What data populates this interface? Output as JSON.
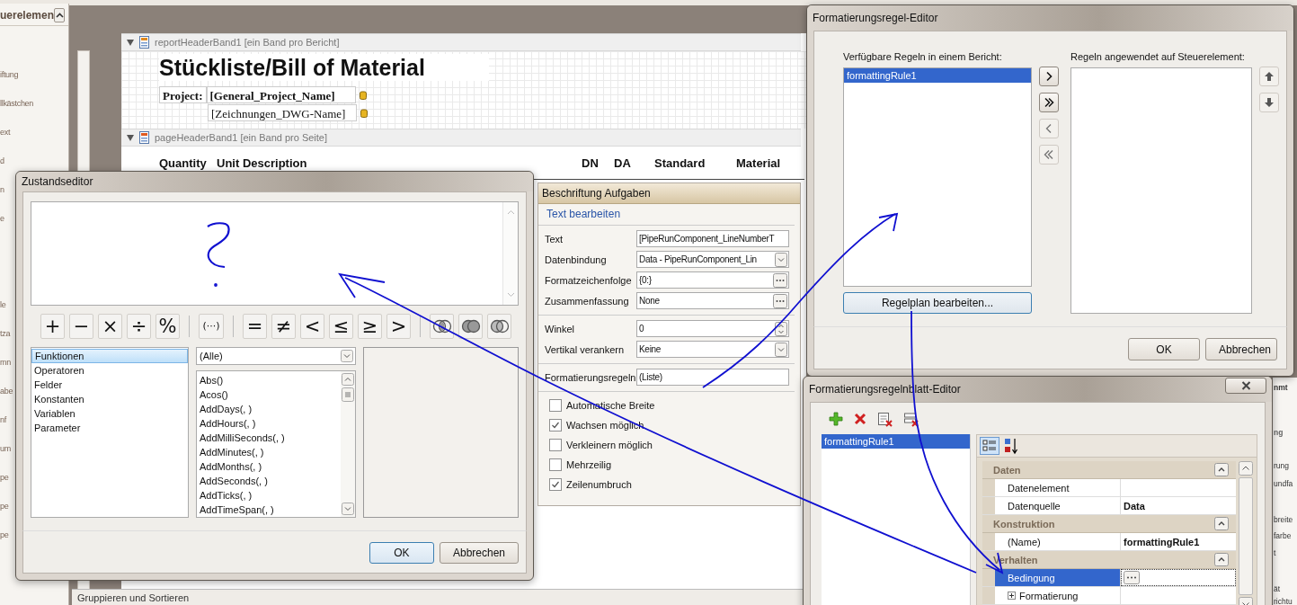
{
  "sidebar": {
    "header": "uerelemen",
    "items": [
      "iftung",
      "llkästchen",
      "ext",
      "d",
      "n",
      "e"
    ],
    "lower_items": [
      "le",
      "tza",
      "mn",
      "abe",
      "nf",
      "um",
      "pe",
      "pe",
      "pe"
    ]
  },
  "report": {
    "bands": [
      {
        "name": "reportHeaderBand1 [ein Band pro Bericht]",
        "kind": "report"
      },
      {
        "name": "pageHeaderBand1 [ein Band pro Seite]",
        "kind": "page"
      }
    ],
    "title": "Stückliste/Bill of Material",
    "project_label": "Project:",
    "fields": [
      {
        "text": "[General_Project_Name]",
        "bold": true
      },
      {
        "text": "[Zeichnungen_DWG-Name]",
        "bold": false
      }
    ],
    "columns": [
      "Quantity",
      "Unit Description",
      "DN",
      "DA",
      "Standard",
      "Material"
    ]
  },
  "bottom_tab": "Gruppieren und Sortieren",
  "right_fragments": [
    "nmt",
    "ng",
    "rung",
    "undfa",
    "breite",
    "farbe",
    "t",
    "ät",
    "richtu"
  ],
  "condition_editor": {
    "title": "Zustandseditor",
    "operators": [
      {
        "text": "+",
        "kind": "char"
      },
      {
        "text": "−",
        "kind": "char"
      },
      {
        "text": "×",
        "kind": "char"
      },
      {
        "text": "÷",
        "kind": "char"
      },
      {
        "text": "%",
        "kind": "char"
      },
      {
        "kind": "sep"
      },
      {
        "text": "(···)",
        "kind": "char"
      },
      {
        "kind": "sep"
      },
      {
        "text": "=",
        "kind": "char"
      },
      {
        "text": "≠",
        "kind": "char"
      },
      {
        "text": "<",
        "kind": "char"
      },
      {
        "text": "≤",
        "kind": "char"
      },
      {
        "text": "≥",
        "kind": "char"
      },
      {
        "text": ">",
        "kind": "char"
      },
      {
        "kind": "sep"
      },
      {
        "kind": "and"
      },
      {
        "kind": "or"
      },
      {
        "kind": "not"
      }
    ],
    "categories": [
      {
        "label": "Funktionen",
        "selected": true
      },
      {
        "label": "Operatoren",
        "selected": false
      },
      {
        "label": "Felder",
        "selected": false
      },
      {
        "label": "Konstanten",
        "selected": false
      },
      {
        "label": "Variablen",
        "selected": false
      },
      {
        "label": "Parameter",
        "selected": false
      }
    ],
    "filter": "(Alle)",
    "functions": [
      "Abs()",
      "Acos()",
      "AddDays(, )",
      "AddHours(, )",
      "AddMilliSeconds(, )",
      "AddMinutes(, )",
      "AddMonths(, )",
      "AddSeconds(, )",
      "AddTicks(, )",
      "AddTimeSpan(, )"
    ],
    "buttons": [
      {
        "label": "OK",
        "kind": "default"
      },
      {
        "label": "Abbrechen",
        "kind": "normal"
      }
    ]
  },
  "tasks_panel": {
    "title": "Beschriftung Aufgaben",
    "link": "Text bearbeiten",
    "groups": [
      [
        {
          "label": "Text",
          "value": "[PipeRunComponent_LineNumberT",
          "kind": "text"
        },
        {
          "label": "Datenbindung",
          "value": "Data - PipeRunComponent_Lin",
          "kind": "dropdown"
        },
        {
          "label": "Formatzeichenfolge",
          "value": "{0:}",
          "kind": "ellipsis"
        },
        {
          "label": "Zusammenfassung",
          "value": "None",
          "kind": "ellipsis"
        }
      ],
      [
        {
          "label": "Winkel",
          "value": "0",
          "kind": "spinner"
        },
        {
          "label": "Vertikal verankern",
          "value": "Keine",
          "kind": "dropdown"
        }
      ],
      [
        {
          "label": "Formatierungsregeln",
          "value": "(Liste)",
          "kind": "text"
        }
      ]
    ],
    "checkboxes": [
      {
        "label": "Automatische Breite",
        "checked": false
      },
      {
        "label": "Wachsen möglich",
        "checked": true
      },
      {
        "label": "Verkleinern möglich",
        "checked": false
      },
      {
        "label": "Mehrzeilig",
        "checked": false
      },
      {
        "label": "Zeilenumbruch",
        "checked": true
      }
    ]
  },
  "rule_editor": {
    "title": "Formatierungsregel-Editor",
    "available_label": "Verfügbare Regeln in einem Bericht:",
    "available": [
      {
        "label": "formattingRule1",
        "selected": true
      }
    ],
    "applied_label": "Regeln angewendet auf Steuerelement:",
    "move_buttons": [
      {
        "kind": "add",
        "disabled": false
      },
      {
        "kind": "add_all",
        "disabled": false
      },
      {
        "kind": "remove",
        "disabled": true
      },
      {
        "kind": "remove_all",
        "disabled": true
      }
    ],
    "edit_button": "Regelplan bearbeiten...",
    "buttons": [
      "OK",
      "Abbrechen"
    ]
  },
  "rule_sheet_editor": {
    "title": "Formatierungsregelnblatt-Editor",
    "rules": [
      {
        "label": "formattingRule1",
        "selected": true
      }
    ],
    "categories": [
      {
        "name": "Daten",
        "rows": [
          {
            "label": "Datenelement",
            "kind": "plain",
            "selected": false
          },
          {
            "label": "Datenquelle",
            "value": "Data",
            "bold": true,
            "kind": "plain",
            "selected": false
          }
        ]
      },
      {
        "name": "Konstruktion",
        "rows": [
          {
            "label": "(Name)",
            "value": "formattingRule1",
            "bold": true,
            "kind": "plain",
            "selected": false
          }
        ]
      },
      {
        "name": "Verhalten",
        "rows": [
          {
            "label": "Bedingung",
            "kind": "ellipsis",
            "selected": true
          },
          {
            "label": "Formatierung",
            "kind": "expandable",
            "selected": false
          }
        ]
      }
    ]
  }
}
